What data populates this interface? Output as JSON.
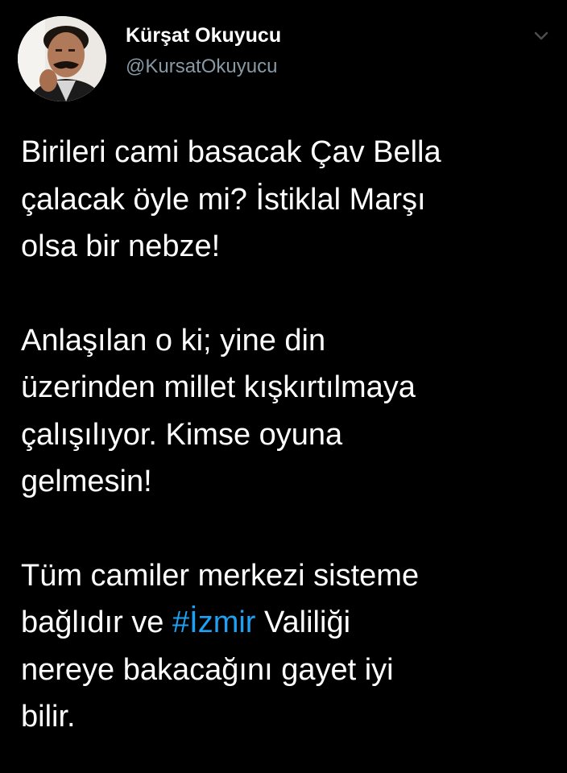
{
  "author": {
    "display_name": "Kürşat Okuyucu",
    "handle": "@KursatOkuyucu"
  },
  "icons": {
    "menu": "chevron-down-icon"
  },
  "tweet": {
    "paragraphs": [
      {
        "lines": [
          "Birileri cami basacak Çav Bella",
          "çalacak öyle mi? İstiklal Marşı",
          "olsa bir nebze!"
        ]
      },
      {
        "lines": [
          "Anlaşılan o ki; yine din",
          "üzerinden millet kışkırtılmaya",
          "çalışılıyor. Kimse oyuna",
          "gelmesin!"
        ]
      },
      {
        "line1": "Tüm camiler merkezi sisteme",
        "line2_before": "bağlıdır ve ",
        "hashtag": "#İzmir",
        "line2_after": " Valiliği",
        "line3": "nereye bakacağını gayet iyi",
        "line4": "bilir."
      }
    ]
  },
  "colors": {
    "background": "#000000",
    "text": "#ffffff",
    "secondary": "#8899a6",
    "link": "#1da1f2"
  }
}
